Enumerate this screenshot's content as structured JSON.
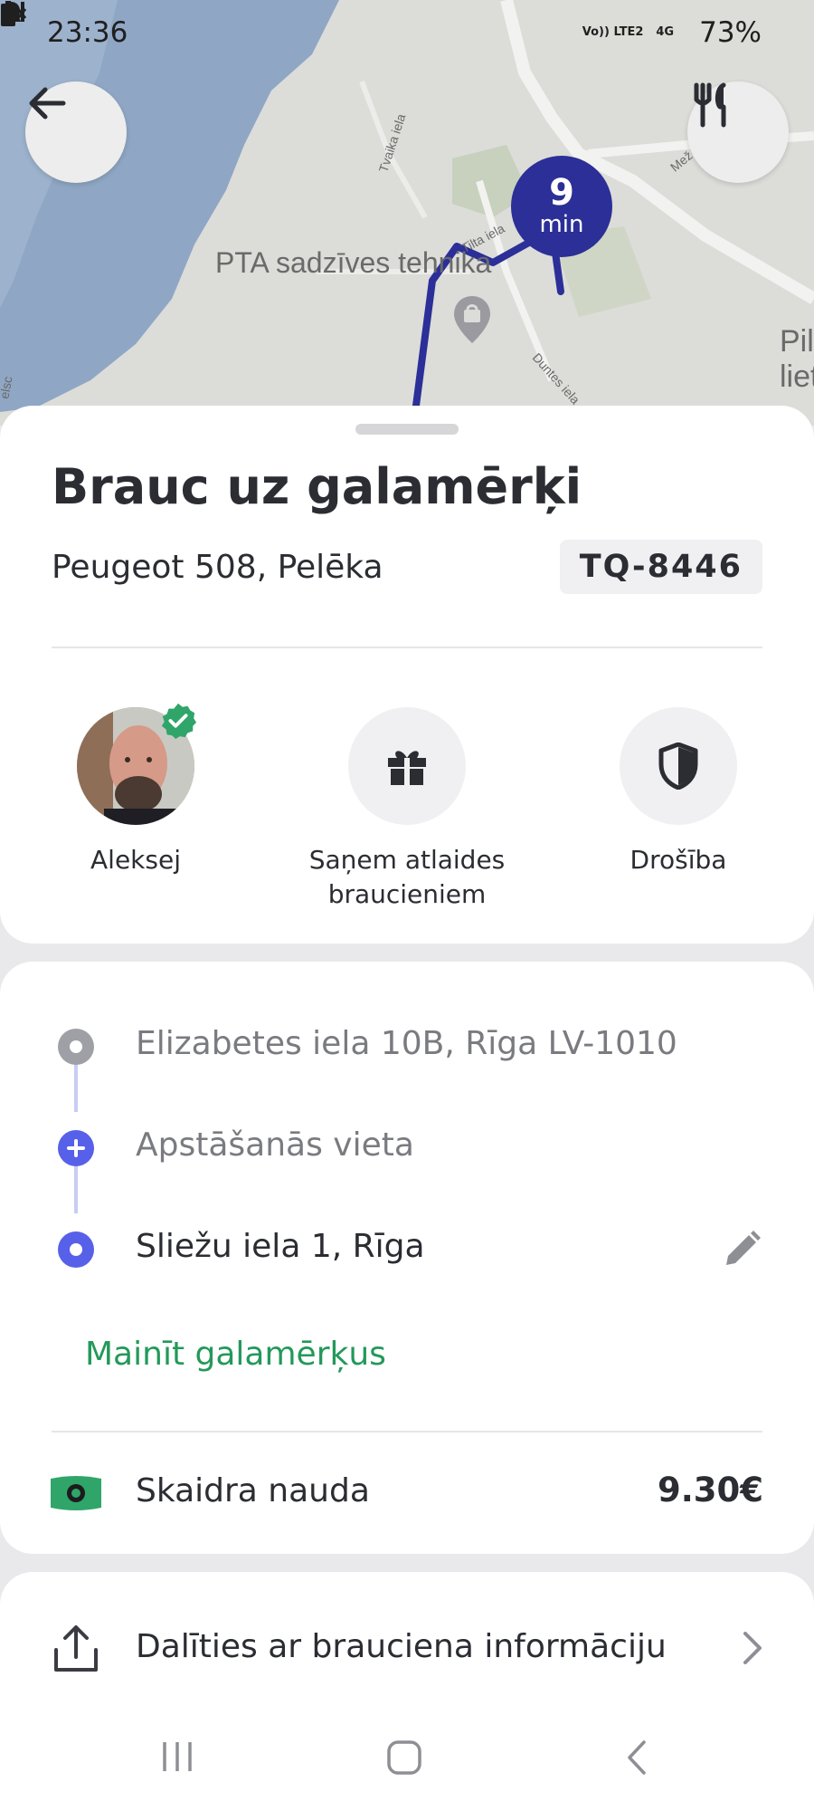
{
  "status_bar": {
    "time": "23:36",
    "network_top": "Vo)) LTE2",
    "network_type": "4G",
    "battery": "73%"
  },
  "map": {
    "labels": {
      "poi": "PTA sadzīves tehnika",
      "street1": "Tvaika iela",
      "street2": "Tilta iela",
      "street3": "Duntes iela",
      "street4": "Mež",
      "edge_right": "Pil liet",
      "edge_left": "elsc"
    },
    "eta": {
      "value": "9",
      "unit": "min"
    },
    "route_color": "#2b2f97"
  },
  "trip": {
    "title": "Brauc uz galamērķi",
    "car": "Peugeot 508, Pelēka",
    "plate": "TQ-8446"
  },
  "actions": [
    {
      "label": "Aleksej",
      "icon": "driver-avatar"
    },
    {
      "label": "Saņem atlaides braucieniem",
      "icon": "gift-icon"
    },
    {
      "label": "Drošība",
      "icon": "shield-icon"
    }
  ],
  "route": {
    "pickup": "Elizabetes iela 10B, Rīga LV-1010",
    "stop": "Apstāšanās vieta",
    "destination": "Sliežu iela 1, Rīga",
    "change_link": "Mainīt galamērķus"
  },
  "payment": {
    "method": "Skaidra nauda",
    "amount": "9.30€",
    "accent": "#23995a"
  },
  "share": {
    "label": "Dalīties ar brauciena informāciju"
  }
}
